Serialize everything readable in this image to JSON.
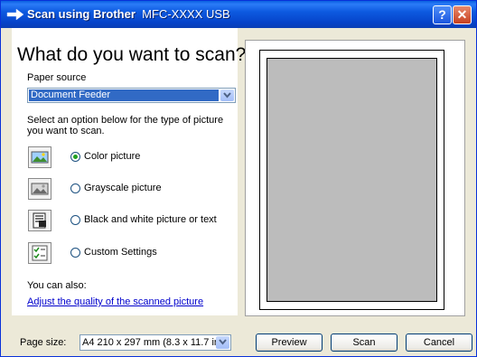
{
  "window": {
    "title_app": "Scan using Brother",
    "title_model": "MFC-XXXX  USB",
    "help_label": "?",
    "close_label": "✕",
    "accent": "#0a5fe0"
  },
  "main": {
    "heading": "What do you want to scan?",
    "paper_source_label": "Paper source",
    "paper_source_value": "Document Feeder",
    "description": "Select an option below for the type of picture you want to scan.",
    "options": [
      {
        "label": "Color picture",
        "icon": "color-picture-icon",
        "selected": true
      },
      {
        "label": "Grayscale picture",
        "icon": "grayscale-picture-icon",
        "selected": false
      },
      {
        "label": "Black and white picture or text",
        "icon": "bw-picture-text-icon",
        "selected": false
      },
      {
        "label": "Custom Settings",
        "icon": "custom-settings-icon",
        "selected": false
      }
    ],
    "you_can_also": "You can also:",
    "adjust_link": "Adjust the quality of the scanned picture"
  },
  "footer": {
    "page_size_label": "Page size:",
    "page_size_value": "A4 210 x 297 mm (8.3 x 11.7 inch",
    "preview_button": "Preview",
    "scan_button": "Scan",
    "cancel_button": "Cancel"
  }
}
